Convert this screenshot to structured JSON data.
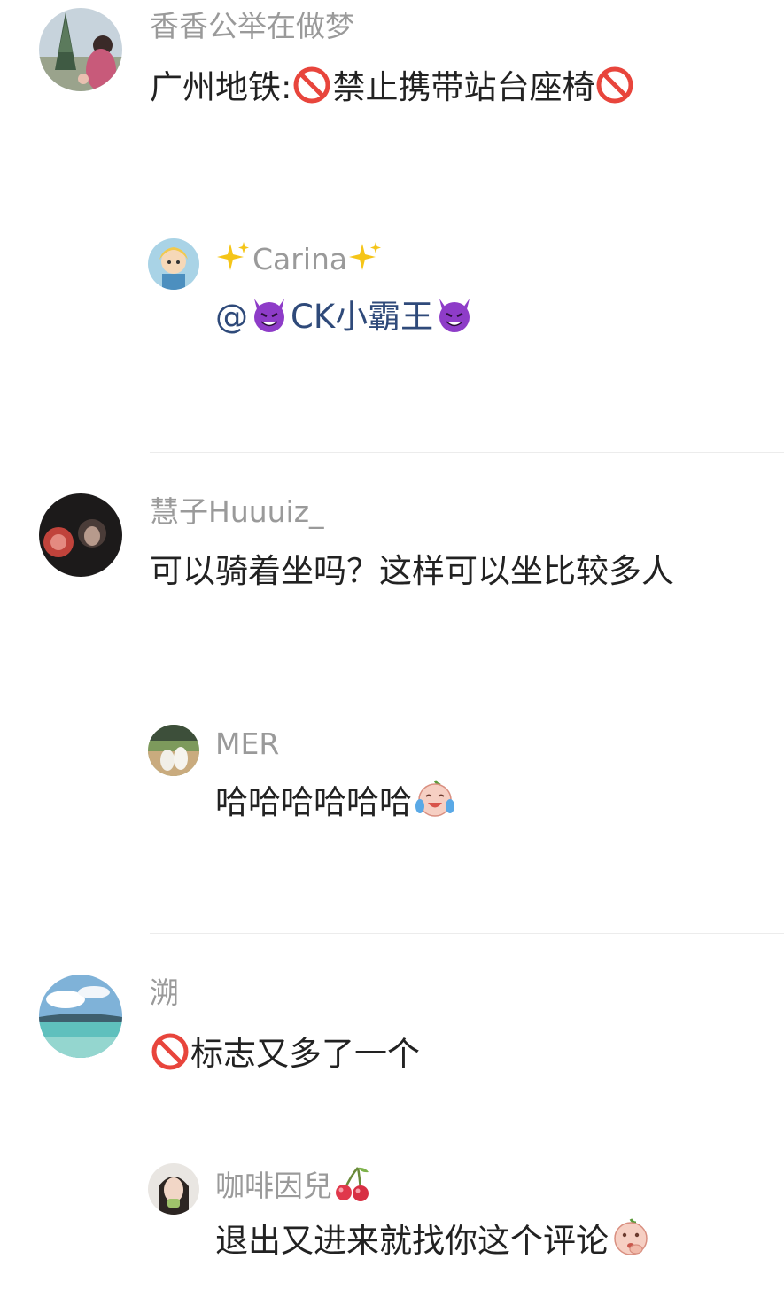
{
  "comments": [
    {
      "name": "香香公举在做梦",
      "text_before": "广州地铁:",
      "text_mid": "禁止携带站台座椅",
      "emoji": "prohibited-icon",
      "reply": {
        "name_sparkle": "sparkles-icon",
        "name": "Carina",
        "at": "@",
        "mention": "CK小霸王",
        "emoji": "smiling-devil-icon"
      }
    },
    {
      "name": "慧子Huuuiz_",
      "text": "可以骑着坐吗？这样可以坐比较多人",
      "reply": {
        "name": "MER",
        "text": "哈哈哈哈哈哈",
        "emoji": "laughing-crying-face-icon"
      }
    },
    {
      "name": "溯",
      "text": "标志又多了一个",
      "emoji": "prohibited-icon",
      "reply": {
        "name": "咖啡因兒",
        "name_emoji": "cherries-icon",
        "text": "退出又进来就找你这个评论",
        "emoji": "thinking-face-icon"
      }
    }
  ],
  "colors": {
    "name": "#9a9a9a",
    "text": "#222222",
    "mention": "#2f4a7a",
    "prohibited": "#e8453c",
    "devil": "#8e3cc8"
  }
}
